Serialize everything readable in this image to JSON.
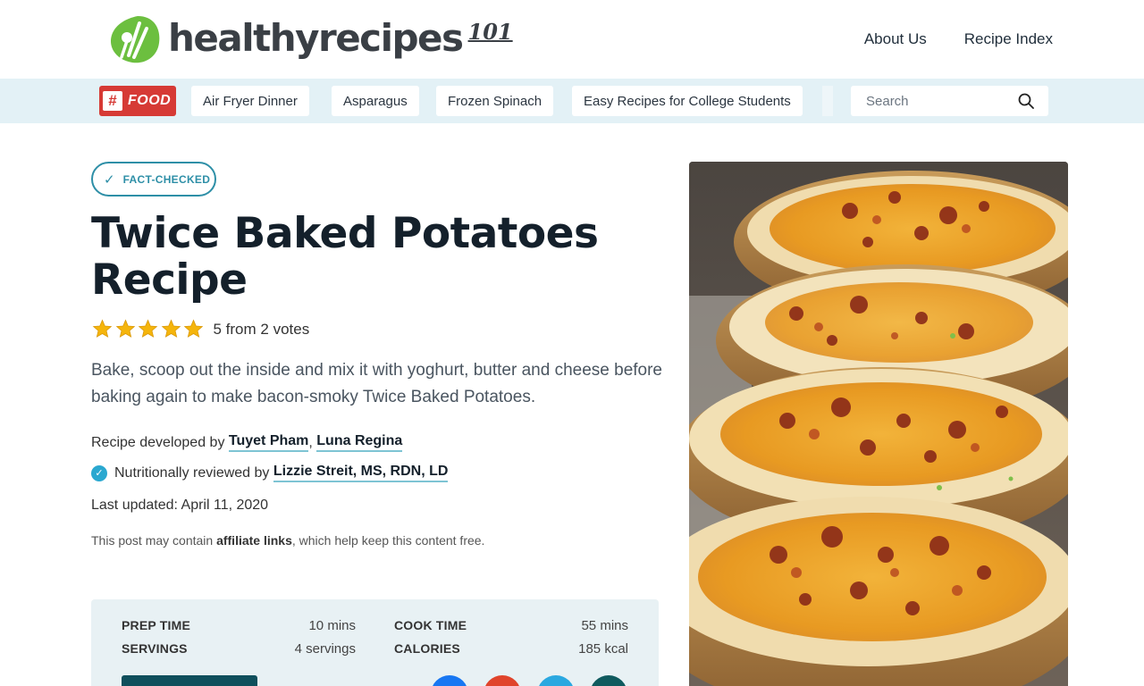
{
  "header": {
    "logo_text": "healthyrecipes",
    "logo_sup": "101",
    "nav": [
      {
        "label": "About Us"
      },
      {
        "label": "Recipe Index"
      }
    ]
  },
  "tagbar": {
    "badge_hash": "#",
    "badge_label": "FOOD",
    "tags": [
      {
        "label": "Air Fryer Dinner"
      },
      {
        "label": "Asparagus"
      },
      {
        "label": "Frozen Spinach"
      },
      {
        "label": "Easy Recipes for College Students"
      }
    ],
    "search_placeholder": "Search"
  },
  "article": {
    "badge": "FACT-CHECKED",
    "title": "Twice Baked Potatoes Recipe",
    "rating": {
      "value": 5,
      "stars": 5,
      "text": "5 from 2 votes"
    },
    "description": "Bake, scoop out the inside and mix it with yoghurt, butter and cheese before baking again to make bacon-smoky Twice Baked Potatoes.",
    "developed_prefix": "Recipe developed by",
    "authors": [
      "Tuyet Pham",
      "Luna Regina"
    ],
    "reviewed_prefix": "Nutritionally reviewed by",
    "reviewer": "Lizzie Streit, MS, RDN, LD",
    "updated_prefix": "Last updated:",
    "updated_date": "April 11, 2020",
    "disclaimer_before": "This post may contain",
    "disclaimer_link": "affiliate links",
    "disclaimer_after": ", which help keep this content free."
  },
  "recipe_info": {
    "prep_time_label": "PREP TIME",
    "prep_time_value": "10 mins",
    "cook_time_label": "COOK TIME",
    "cook_time_value": "55 mins",
    "servings_label": "SERVINGS",
    "servings_value": "4 servings",
    "calories_label": "CALORIES",
    "calories_value": "185 kcal"
  },
  "colors": {
    "accent": "#2e8fa7",
    "tagbar_bg": "#e3f1f6",
    "food_badge": "#d63a35",
    "logo_green": "#6cbf3f",
    "star": "#f5b50c"
  },
  "icons": [
    "logo-leaf-icon",
    "hash-icon",
    "search-icon",
    "check-icon",
    "star-icon",
    "verified-icon"
  ]
}
